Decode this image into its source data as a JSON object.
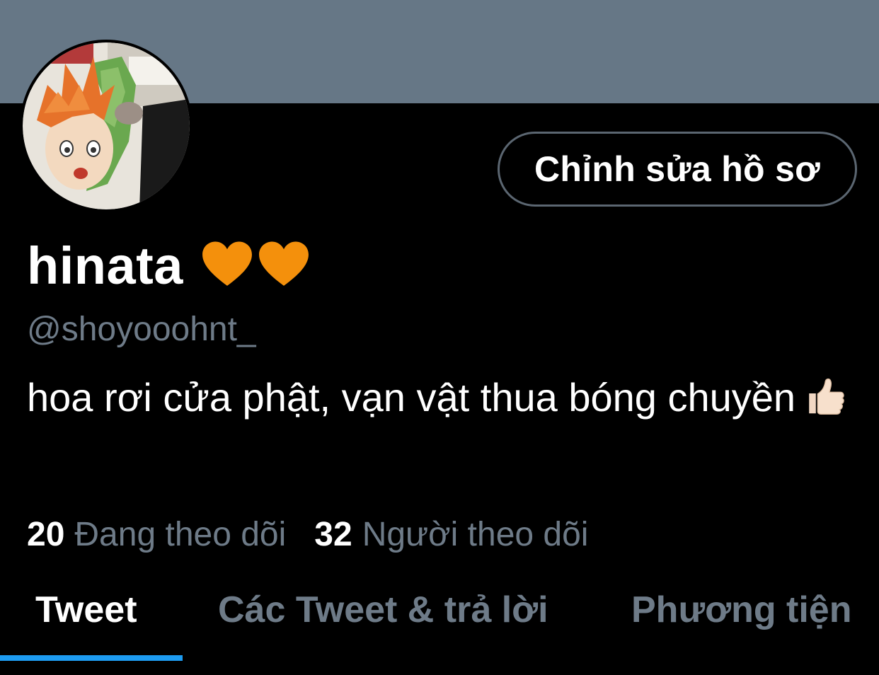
{
  "profile": {
    "edit_button_label": "Chỉnh sửa hồ sơ",
    "display_name": "hinata",
    "handle": "@shoyooohnt_",
    "bio": "hoa rơi cửa phật, vạn vật thua bóng chuyền",
    "bio_emoji": "thumbs-up-light-skin-tone",
    "name_emoji": "orange-heart x2"
  },
  "stats": {
    "following_count": "20",
    "following_label": "Đang theo dõi",
    "followers_count": "32",
    "followers_label": "Người theo dõi"
  },
  "tabs": [
    {
      "label": "Tweet",
      "active": true
    },
    {
      "label": "Các Tweet & trả lời",
      "active": false
    },
    {
      "label": "Phương tiện",
      "active": false
    }
  ],
  "colors": {
    "banner": "#667786",
    "background": "#000000",
    "secondary_text": "#6e7b88",
    "accent": "#1d9bf0",
    "heart": "#f4900c"
  }
}
